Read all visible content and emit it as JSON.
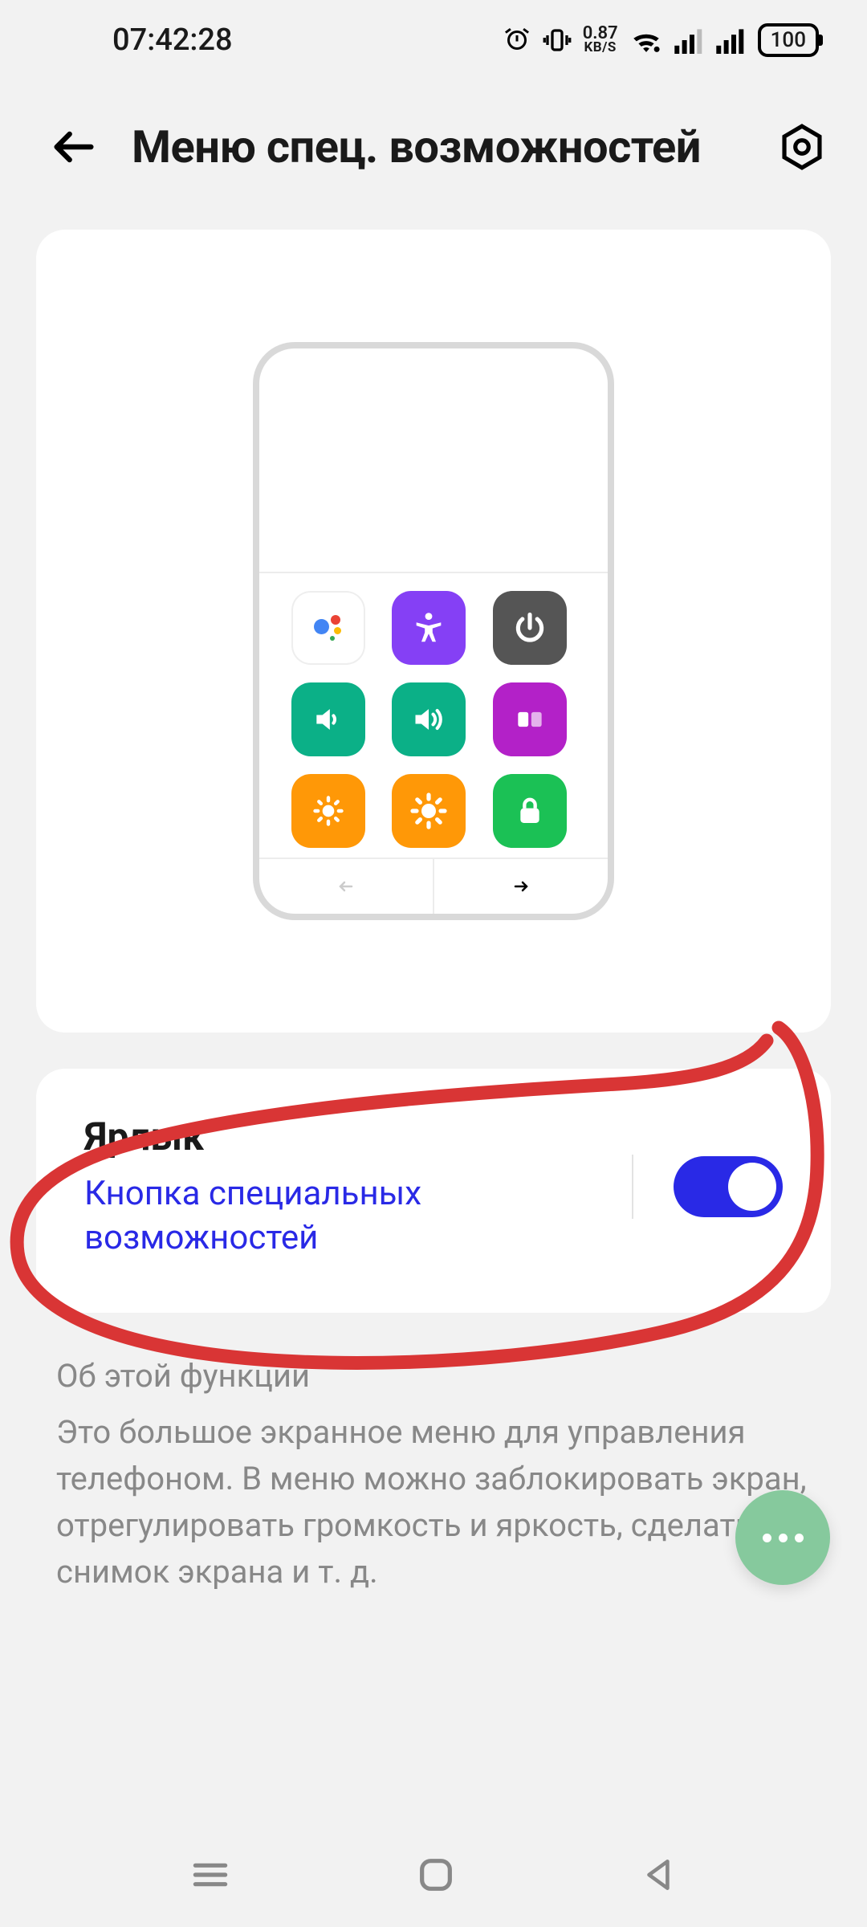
{
  "status": {
    "time": "07:42:28",
    "net_speed_value": "0.87",
    "net_speed_unit": "KB/S",
    "battery": "100"
  },
  "header": {
    "title": "Меню спец. возможностей"
  },
  "preview": {
    "tiles": [
      {
        "name": "assistant-icon",
        "class": "t-white"
      },
      {
        "name": "accessibility-icon",
        "class": "t-purple"
      },
      {
        "name": "power-icon",
        "class": "t-dark"
      },
      {
        "name": "volume-down-icon",
        "class": "t-teal"
      },
      {
        "name": "volume-up-icon",
        "class": "t-teal"
      },
      {
        "name": "recents-icon",
        "class": "t-magenta"
      },
      {
        "name": "brightness-down-icon",
        "class": "t-orange"
      },
      {
        "name": "brightness-up-icon",
        "class": "t-orange"
      },
      {
        "name": "lock-icon",
        "class": "t-green"
      }
    ]
  },
  "shortcut": {
    "title": "Ярлык",
    "subtitle": "Кнопка специальных возможностей",
    "enabled": true
  },
  "about": {
    "heading": "Об этой функции",
    "body": "Это большое экранное меню для управления телефоном. В меню можно заблокировать экран, отрегулировать громкость и яркость, сделать снимок экрана и т. д."
  },
  "annotation": {
    "type": "hand-drawn-circle",
    "target": "shortcut-card",
    "color": "#d93535"
  }
}
